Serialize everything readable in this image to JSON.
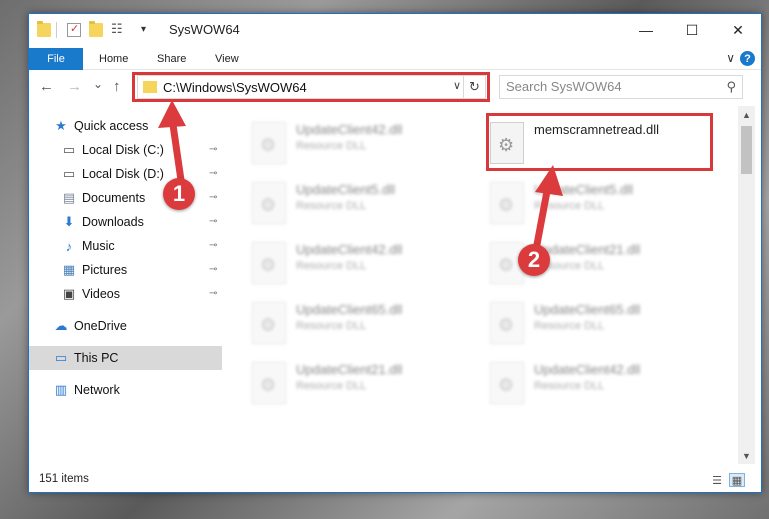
{
  "window": {
    "title": "SysWOW64",
    "minimize": "—",
    "maximize": "☐",
    "close": "✕"
  },
  "ribbon": {
    "tabs": [
      "File",
      "Home",
      "Share",
      "View"
    ],
    "expand": "∨",
    "help": "?"
  },
  "nav": {
    "back": "←",
    "forward": "→",
    "recent": "⌄",
    "up": "↑",
    "address": "C:\\Windows\\SysWOW64",
    "address_dropdown": "∨",
    "refresh": "↻",
    "search_placeholder": "Search SysWOW64",
    "search_icon": "⚲"
  },
  "sidebar": {
    "items": [
      {
        "label": "Quick access",
        "icon": "star-icon",
        "glyph": "★",
        "color": "#2b79d1",
        "pinned": false
      },
      {
        "label": "Local Disk (C:)",
        "icon": "drive-icon",
        "glyph": "▭",
        "color": "#555555",
        "pinned": true
      },
      {
        "label": "Local Disk (D:)",
        "icon": "drive-icon",
        "glyph": "▭",
        "color": "#555555",
        "pinned": true
      },
      {
        "label": "Documents",
        "icon": "documents-icon",
        "glyph": "▤",
        "color": "#7a8799",
        "pinned": true
      },
      {
        "label": "Downloads",
        "icon": "download-icon",
        "glyph": "⬇",
        "color": "#2b79d1",
        "pinned": true
      },
      {
        "label": "Music",
        "icon": "music-icon",
        "glyph": "♪",
        "color": "#2b79d1",
        "pinned": true
      },
      {
        "label": "Pictures",
        "icon": "pictures-icon",
        "glyph": "▦",
        "color": "#4a7db8",
        "pinned": true
      },
      {
        "label": "Videos",
        "icon": "videos-icon",
        "glyph": "▣",
        "color": "#444444",
        "pinned": true
      },
      {
        "label": "OneDrive",
        "icon": "cloud-icon",
        "glyph": "☁",
        "color": "#2b79d1",
        "pinned": false
      },
      {
        "label": "This PC",
        "icon": "computer-icon",
        "glyph": "▭",
        "color": "#2b79d1",
        "pinned": false
      },
      {
        "label": "Network",
        "icon": "network-icon",
        "glyph": "▥",
        "color": "#2b79d1",
        "pinned": false
      }
    ],
    "pin_glyph": "📌"
  },
  "files": {
    "left": [
      {
        "name": "UpdateClient42.dll",
        "type": "Resource DLL"
      },
      {
        "name": "UpdateClient5.dll",
        "type": "Resource DLL"
      },
      {
        "name": "UpdateClient42.dll",
        "type": "Resource DLL"
      },
      {
        "name": "UpdateClient65.dll",
        "type": "Resource DLL"
      },
      {
        "name": "UpdateClient21.dll",
        "type": "Resource DLL"
      }
    ],
    "right": [
      {
        "name": "memscramnetread.dll",
        "type": ""
      },
      {
        "name": "UpdateClient5.dll",
        "type": "Resource DLL"
      },
      {
        "name": "UpdateClient21.dll",
        "type": "Resource DLL"
      },
      {
        "name": "UpdateClient65.dll",
        "type": "Resource DLL"
      },
      {
        "name": "UpdateClient42.dll",
        "type": "Resource DLL"
      }
    ]
  },
  "status": {
    "count": "151 items"
  },
  "annotations": {
    "step1": "1",
    "step2": "2",
    "color": "#dc3b3d"
  }
}
